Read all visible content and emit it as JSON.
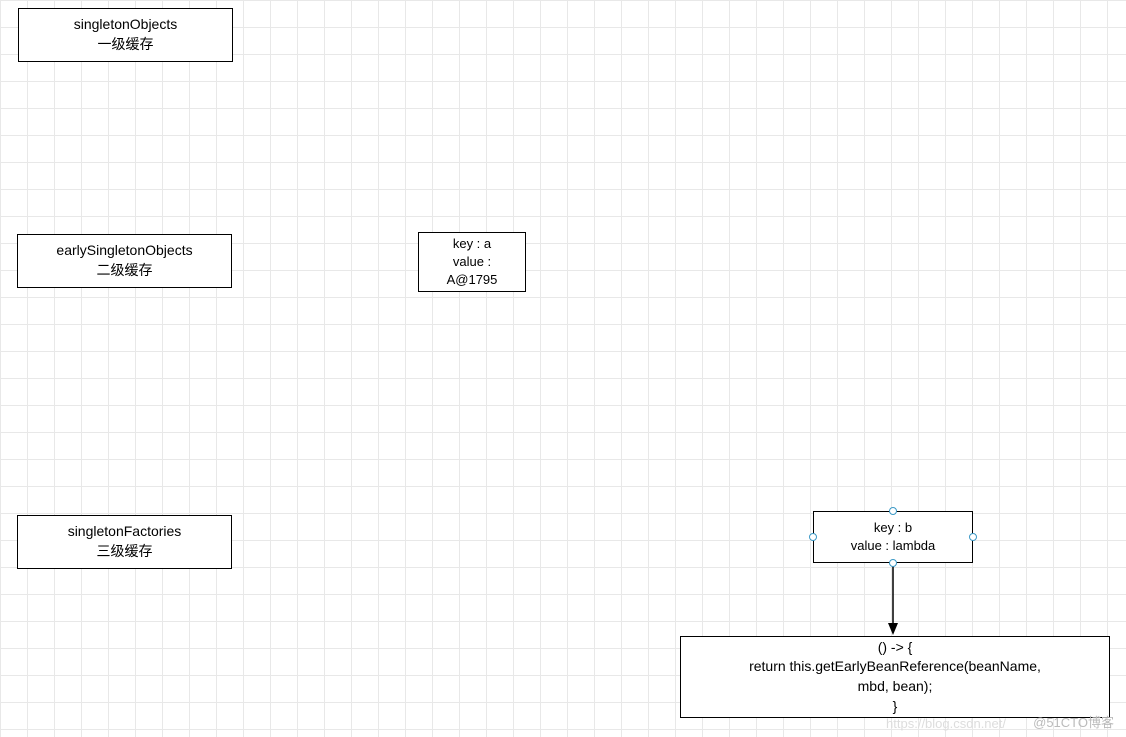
{
  "nodes": {
    "cache1": {
      "title": "singletonObjects",
      "subtitle": "一级缓存"
    },
    "cache2": {
      "title": "earlySingletonObjects",
      "subtitle": "二级缓存"
    },
    "cache3": {
      "title": "singletonFactories",
      "subtitle": "三级缓存"
    },
    "entryA": {
      "line1": "key : a",
      "line2": "value :",
      "line3": "A@1795"
    },
    "entryB": {
      "line1": "key : b",
      "line2": "value : lambda"
    },
    "lambda": {
      "line1": "() -> {",
      "line2": "return this.getEarlyBeanReference(beanName,",
      "line3": "mbd, bean);",
      "line4": "}"
    }
  },
  "watermark": {
    "primary": "@51CTO博客",
    "secondary": "https://blog.csdn.net/"
  }
}
